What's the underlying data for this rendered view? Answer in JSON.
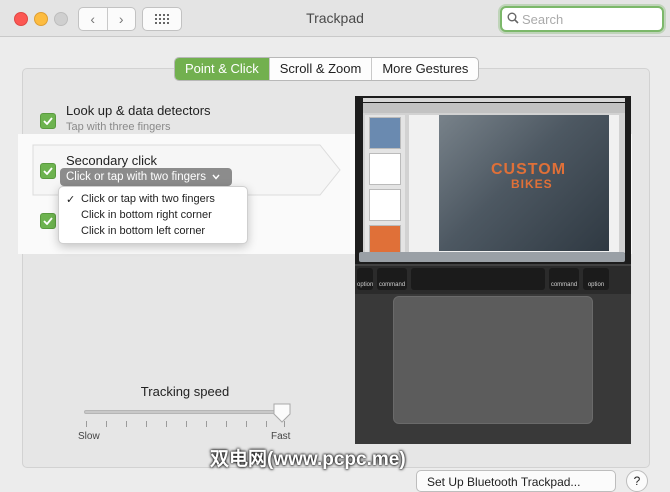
{
  "window": {
    "title": "Trackpad",
    "search_placeholder": "Search"
  },
  "tabs": [
    {
      "label": "Point & Click",
      "active": true
    },
    {
      "label": "Scroll & Zoom",
      "active": false
    },
    {
      "label": "More Gestures",
      "active": false
    }
  ],
  "options": {
    "lookup": {
      "title": "Look up & data detectors",
      "subtitle": "Tap with three fingers",
      "checked": true
    },
    "secondary": {
      "title": "Secondary click",
      "selected": "Click or tap with two fingers",
      "checked": true
    },
    "third": {
      "checked": true
    }
  },
  "secondary_menu": [
    {
      "label": "Click or tap with two fingers",
      "selected": true
    },
    {
      "label": "Click in bottom right corner",
      "selected": false
    },
    {
      "label": "Click in bottom left corner",
      "selected": false
    }
  ],
  "tracking": {
    "title": "Tracking speed",
    "min_label": "Slow",
    "max_label": "Fast",
    "value_fraction": 0.97
  },
  "preview": {
    "headline_1": "CUSTOM",
    "headline_2": "BIKES",
    "keys": [
      "option",
      "command",
      "command",
      "option"
    ]
  },
  "bottom": {
    "bluetooth_button": "Set Up Bluetooth Trackpad...",
    "help_button": "?"
  },
  "watermark": "双电网(www.pcpc.me)",
  "colors": {
    "accent": "#72b04f",
    "checkbox": "#6db34f",
    "close": "#fc5753",
    "minimize": "#fdbc40",
    "headline": "#e07038"
  }
}
